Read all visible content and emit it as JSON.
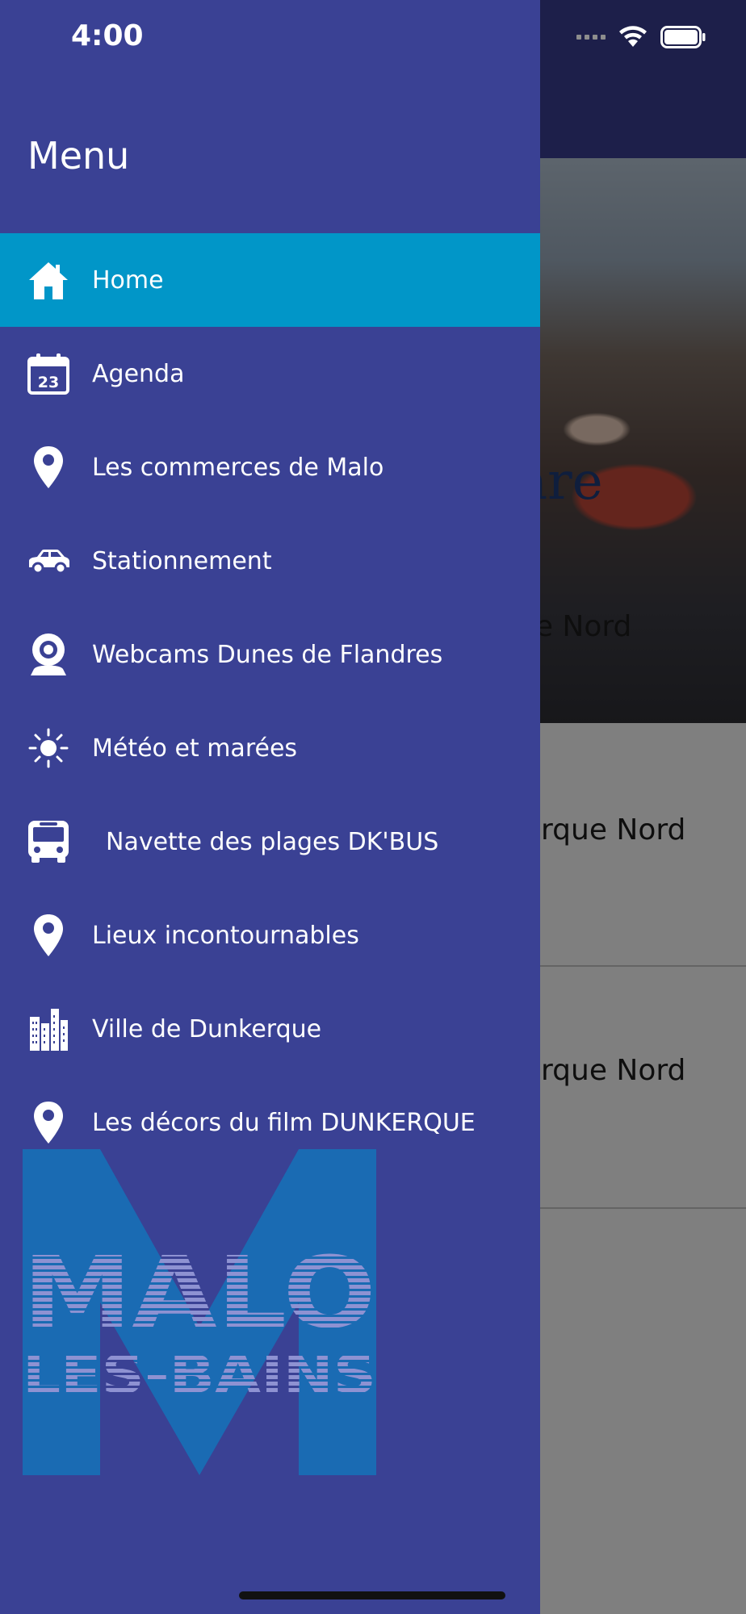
{
  "status_bar": {
    "time": "4:00"
  },
  "background": {
    "hero_title": "are",
    "hero_subtitle": "ue Nord",
    "list_items": [
      "rque Nord",
      "rque Nord"
    ]
  },
  "drawer": {
    "title": "Menu",
    "items": [
      {
        "label": "Home",
        "icon": "home-icon",
        "active": true
      },
      {
        "label": "Agenda",
        "icon": "calendar-icon",
        "active": false
      },
      {
        "label": "Les commerces de Malo",
        "icon": "map-pin-icon",
        "active": false
      },
      {
        "label": "Stationnement",
        "icon": "car-icon",
        "active": false
      },
      {
        "label": "Webcams Dunes de Flandres",
        "icon": "webcam-icon",
        "active": false
      },
      {
        "label": "Météo et marées",
        "icon": "sun-icon",
        "active": false
      },
      {
        "label": "Navette des plages DK'BUS",
        "icon": "bus-icon",
        "active": false
      },
      {
        "label": "Lieux incontournables",
        "icon": "map-pin-icon",
        "active": false
      },
      {
        "label": "Ville de Dunkerque",
        "icon": "city-icon",
        "active": false
      },
      {
        "label": "Les décors du film DUNKERQUE",
        "icon": "map-pin-icon",
        "active": false
      }
    ],
    "calendar_day": "23"
  },
  "logo": {
    "line1": "MALO",
    "line2": "LES-BAINS",
    "letter": "M"
  },
  "colors": {
    "drawer_bg": "#3a4194",
    "active_item_bg": "#0196c8",
    "logo_m": "#1a6bb3",
    "logo_text": "#8e92d2"
  }
}
